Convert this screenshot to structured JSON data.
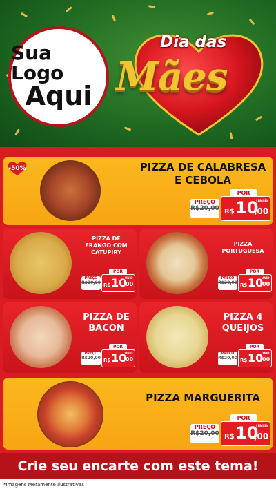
{
  "header": {
    "logo_line1": "Sua Logo",
    "logo_line2": "Aqui",
    "title_small": "Dia das",
    "title_big": "Mães"
  },
  "featured_top": {
    "badge": "-50%",
    "name_line1": "PIZZA DE CALABRESA",
    "name_line2": "E CEBOLA",
    "preco_label": "PREÇO",
    "old_price": "R$20,00",
    "por_label": "POR",
    "currency": "R$",
    "price_int": "10",
    "price_dec": ",00",
    "unit": "UNID"
  },
  "grid": [
    {
      "name_line1": "PIZZA DE",
      "name_line2": "FRANGO COM",
      "name_line3": "CATUPIRY",
      "preco_label": "PREÇO",
      "old_price": "R$20,00",
      "por_label": "POR",
      "currency": "R$",
      "price_int": "10",
      "price_dec": ",00",
      "unit": "UNID"
    },
    {
      "name_line1": "PIZZA",
      "name_line2": "PORTUGUESA",
      "name_line3": "",
      "preco_label": "PREÇO",
      "old_price": "R$20,00",
      "por_label": "POR",
      "currency": "R$",
      "price_int": "10",
      "price_dec": ",00",
      "unit": "UNID"
    },
    {
      "name_line1": "PIZZA DE",
      "name_line2": "BACON",
      "name_line3": "",
      "preco_label": "PREÇO",
      "old_price": "R$20,00",
      "por_label": "POR",
      "currency": "R$",
      "price_int": "10",
      "price_dec": ",00",
      "unit": "UNID"
    },
    {
      "name_line1": "PIZZA 4",
      "name_line2": "QUEIJOS",
      "name_line3": "",
      "preco_label": "PREÇO",
      "old_price": "R$20,00",
      "por_label": "POR",
      "currency": "R$",
      "price_int": "10",
      "price_dec": ",00",
      "unit": "UNID"
    }
  ],
  "featured_bottom": {
    "name_line1": "PIZZA MARGUERITA",
    "preco_label": "PREÇO",
    "old_price": "R$20,00",
    "por_label": "POR",
    "currency": "R$",
    "price_int": "10",
    "price_dec": ",00",
    "unit": "UNID"
  },
  "footer": {
    "cta": "Crie seu encarte com este tema!",
    "disclaimer": "*Imagens Meramente Ilustrativas"
  },
  "colors": {
    "brand_red": "#d81c22",
    "card_yellow": "#fbb81d",
    "header_green": "#1f6a22",
    "title_gold": "#f2c531"
  }
}
